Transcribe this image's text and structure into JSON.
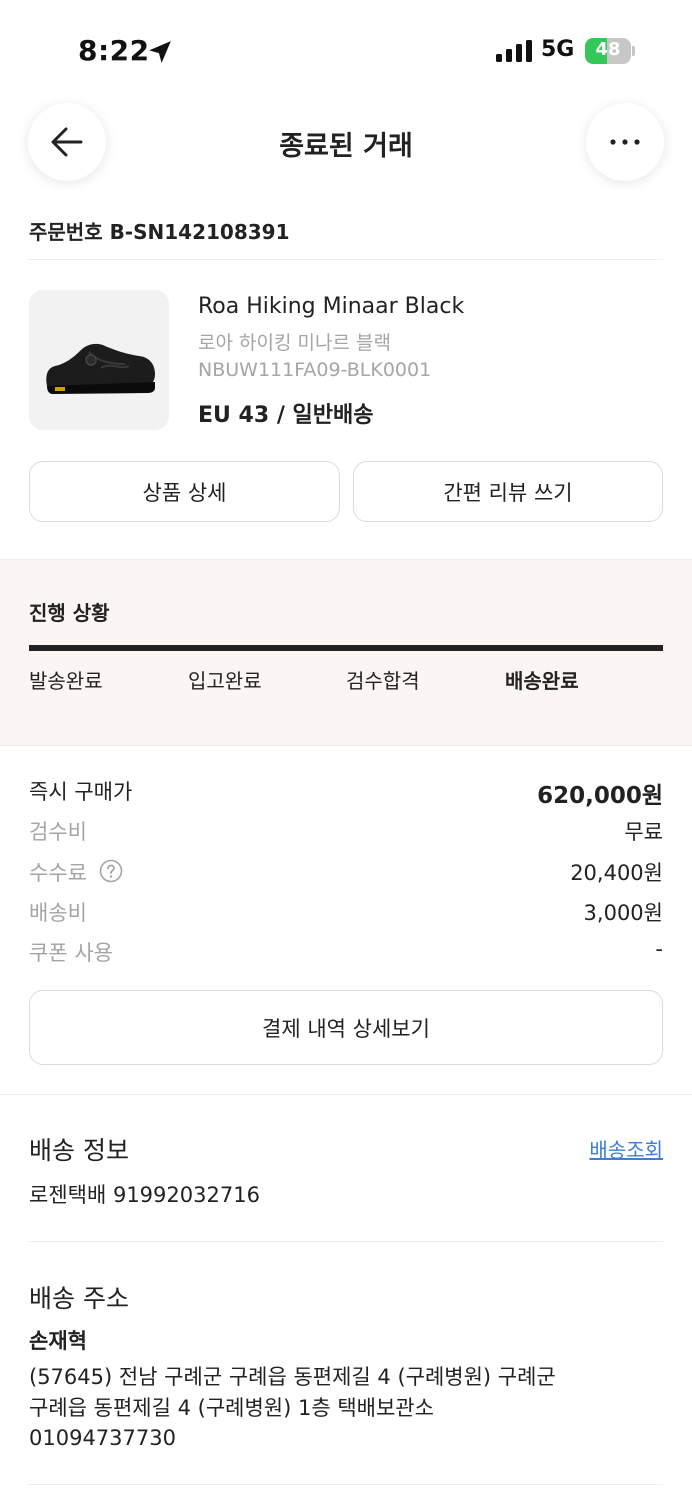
{
  "status_bar": {
    "time": "8:22",
    "network": "5G",
    "battery_level": "48",
    "battery_fraction": 0.48,
    "icons": [
      "location-arrow-icon",
      "cellular-signal-icon",
      "battery-charging-icon"
    ]
  },
  "header": {
    "title": "종료된 거래",
    "back_icon": "arrow-left-icon",
    "more_icon": "more-horizontal-icon"
  },
  "order": {
    "number": "주문번호 B-SN142108391"
  },
  "product": {
    "name_en": "Roa Hiking Minaar Black",
    "name_ko": "로아 하이킹 미나르 블랙",
    "code": "NBUW111FA09-BLK0001",
    "option": "EU 43 / 일반배송",
    "image": "black-hiking-shoe"
  },
  "actions": {
    "detail_label": "상품 상세",
    "review_label": "간편 리뷰 쓰기"
  },
  "progress": {
    "title": "진행 상황",
    "steps": [
      "발송완료",
      "입고완료",
      "검수합격",
      "배송완료"
    ],
    "current_step": 4,
    "completion": 1.0
  },
  "price": {
    "rows": [
      {
        "label": "즉시 구매가",
        "value": "620,000원"
      },
      {
        "label": "검수비",
        "value": "무료"
      },
      {
        "label": "수수료",
        "value": "20,400원",
        "info_icon": "question-circle-icon"
      },
      {
        "label": "배송비",
        "value": "3,000원"
      },
      {
        "label": "쿠폰 사용",
        "value": "-"
      }
    ],
    "payment_detail_label": "결제 내역 상세보기"
  },
  "shipping": {
    "title": "배송 정보",
    "track_label": "배송조회",
    "carrier_info": "로젠택배 91992032716"
  },
  "address": {
    "title": "배송 주소",
    "recipient": "손재혁",
    "line1": "(57645) 전남 구례군 구례읍 동편제길 4 (구례병원) 구례군",
    "line2": "구례읍 동편제길 4 (구례병원) 1층 택배보관소",
    "phone": "01094737730"
  },
  "colors": {
    "accent_link": "#3e7fcf",
    "progress_bg": "#fbf5f4",
    "battery_green": "#34c759"
  }
}
